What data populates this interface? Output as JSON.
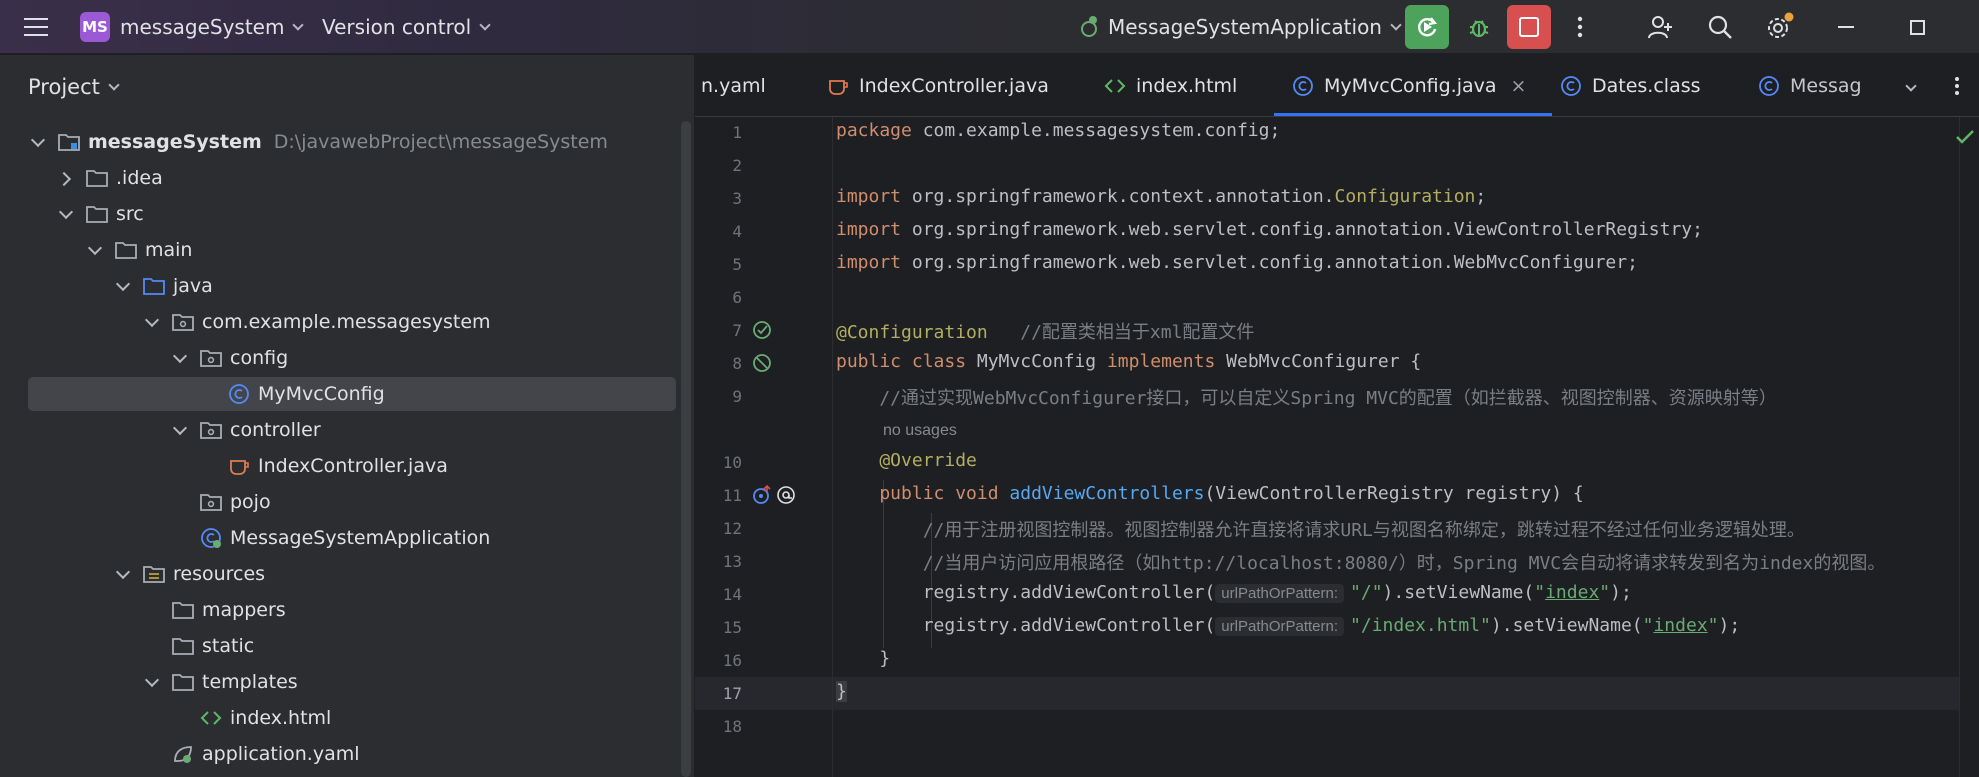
{
  "titlebar": {
    "project_badge": "MS",
    "project_name": "messageSystem",
    "vcs_label": "Version control",
    "run_config": "MessageSystemApplication",
    "accent_green": "#4ea35c",
    "accent_red": "#d84f4f",
    "icons": [
      "menu-icon",
      "run-config-icon",
      "rerun-icon",
      "debug-icon",
      "stop-icon",
      "more-vertical-icon",
      "add-user-icon",
      "search-icon",
      "settings-icon",
      "minimize-icon",
      "maximize-icon"
    ]
  },
  "project_panel": {
    "title": "Project",
    "tree": [
      {
        "label": "messageSystem",
        "path": "D:\\javawebProject\\messageSystem",
        "expanded": true,
        "icon": "module-folder-icon",
        "bold": true
      },
      {
        "label": ".idea",
        "expanded": false,
        "icon": "folder-icon"
      },
      {
        "label": "src",
        "expanded": true,
        "icon": "folder-icon"
      },
      {
        "label": "main",
        "expanded": true,
        "icon": "folder-icon"
      },
      {
        "label": "java",
        "expanded": true,
        "icon": "source-folder-icon"
      },
      {
        "label": "com.example.messagesystem",
        "expanded": true,
        "icon": "package-icon"
      },
      {
        "label": "config",
        "expanded": true,
        "icon": "package-icon"
      },
      {
        "label": "MyMvcConfig",
        "icon": "class-icon",
        "selected": true
      },
      {
        "label": "controller",
        "expanded": true,
        "icon": "package-icon"
      },
      {
        "label": "IndexController.java",
        "icon": "java-file-icon"
      },
      {
        "label": "pojo",
        "icon": "package-icon"
      },
      {
        "label": "MessageSystemApplication",
        "icon": "spring-class-icon"
      },
      {
        "label": "resources",
        "expanded": true,
        "icon": "resources-folder-icon"
      },
      {
        "label": "mappers",
        "icon": "folder-icon"
      },
      {
        "label": "static",
        "icon": "folder-icon"
      },
      {
        "label": "templates",
        "expanded": true,
        "icon": "folder-icon"
      },
      {
        "label": "index.html",
        "icon": "html-file-icon"
      },
      {
        "label": "application.yaml",
        "icon": "yaml-file-icon"
      }
    ]
  },
  "tabs": [
    {
      "label": "n.yaml",
      "icon": ""
    },
    {
      "label": "IndexController.java",
      "icon": "java-file-icon"
    },
    {
      "label": "index.html",
      "icon": "html-file-icon"
    },
    {
      "label": "MyMvcConfig.java",
      "icon": "class-icon",
      "active": true,
      "close": "×"
    },
    {
      "label": "Dates.class",
      "icon": "class-icon"
    },
    {
      "label": "Messag",
      "icon": "class-icon"
    }
  ],
  "editor": {
    "line_numbers": [
      "1",
      "2",
      "3",
      "4",
      "5",
      "6",
      "7",
      "8",
      "9",
      "10",
      "11",
      "12",
      "13",
      "14",
      "15",
      "16",
      "17",
      "18"
    ],
    "current_line": "17",
    "usages_hint": "no usages",
    "inlay_hint": "urlPathOrPattern:",
    "lines": {
      "l1": {
        "kw": "package",
        "rest": " com.example.messagesystem.config;"
      },
      "l3": {
        "kw": "import",
        "a": " org.springframework.context.annotation.",
        "ann": "Configuration",
        "end": ";"
      },
      "l4": {
        "kw": "import",
        "rest": " org.springframework.web.servlet.config.annotation.ViewControllerRegistry;"
      },
      "l5": {
        "kw": "import",
        "rest": " org.springframework.web.servlet.config.annotation.WebMvcConfigurer;"
      },
      "l7": {
        "ann": "@Configuration",
        "cmt": "   //配置类相当于xml配置文件"
      },
      "l8": {
        "kw1": "public class",
        "name": " MyMvcConfig ",
        "kw2": "implements",
        "rest": " WebMvcConfigurer {"
      },
      "l9": {
        "cmt": "    //通过实现WebMvcConfigurer接口，可以自定义Spring MVC的配置（如拦截器、视图控制器、资源映射等）"
      },
      "l10": {
        "ann": "    @Override"
      },
      "l11": {
        "kw": "    public void ",
        "fn": "addViewControllers",
        "rest": "(ViewControllerRegistry registry) {"
      },
      "l12": {
        "cmt": "        //用于注册视图控制器。视图控制器允许直接将请求URL与视图名称绑定，跳转过程不经过任何业务逻辑处理。"
      },
      "l13": {
        "cmt": "        //当用户访问应用根路径（如http://localhost:8080/）时，Spring MVC会自动将请求转发到名为index的视图。"
      },
      "l14": {
        "a": "        registry.addViewController(",
        "str": "\"/\"",
        "b": ").setViewName(",
        "q1": "\"",
        "ul": "index",
        "q2": "\"",
        "end": ");"
      },
      "l15": {
        "a": "        registry.addViewController(",
        "str": "\"/index.html\"",
        "b": ").setViewName(",
        "q1": "\"",
        "ul": "index",
        "q2": "\"",
        "end": ");"
      },
      "l16": {
        "rest": "    }"
      },
      "l17": {
        "rest": "}"
      }
    }
  }
}
